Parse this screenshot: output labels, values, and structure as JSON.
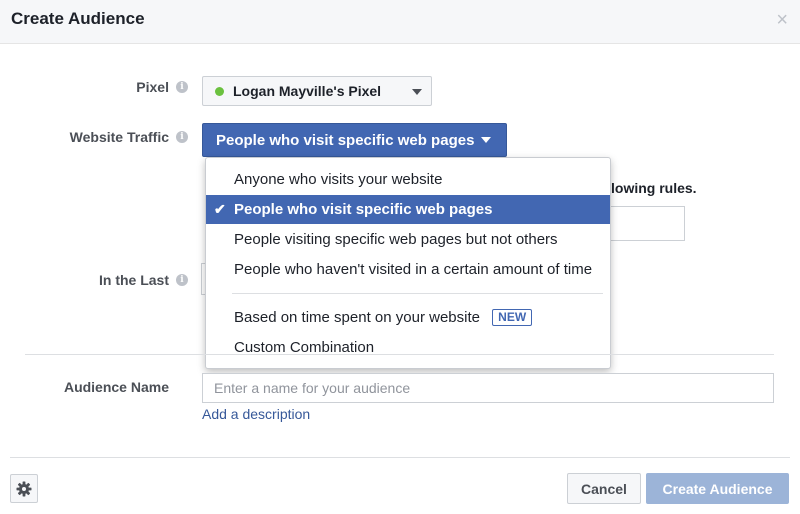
{
  "dialog": {
    "title": "Create Audience",
    "close_icon": "×"
  },
  "form": {
    "pixel_label": "Pixel",
    "pixel_value": "Logan Mayville's Pixel",
    "traffic_label": "Website Traffic",
    "traffic_value": "People who visit specific web pages",
    "rules_text": "lowing rules.",
    "last_label": "In the Last",
    "name_label": "Audience Name",
    "name_placeholder": "Enter a name for your audience",
    "add_description": "Add a description"
  },
  "dropdown": {
    "items": [
      {
        "label": "Anyone who visits your website",
        "selected": false
      },
      {
        "label": "People who visit specific web pages",
        "selected": true
      },
      {
        "label": "People visiting specific web pages but not others",
        "selected": false
      },
      {
        "label": "People who haven't visited in a certain amount of time",
        "selected": false
      },
      {
        "label": "Based on time spent on your website",
        "badge": "NEW",
        "selected": false
      },
      {
        "label": "Custom Combination",
        "selected": false
      }
    ]
  },
  "footer": {
    "cancel_label": "Cancel",
    "create_label": "Create Audience"
  },
  "colors": {
    "accent": "#4267b2",
    "link": "#365899",
    "pixel_status": "#6bc13f",
    "disabled_button": "#9cb4d8"
  },
  "icons": {
    "info": "info-icon",
    "close": "close-icon",
    "gear": "gear-icon",
    "check": "check-icon",
    "caret": "caret-down-icon"
  }
}
